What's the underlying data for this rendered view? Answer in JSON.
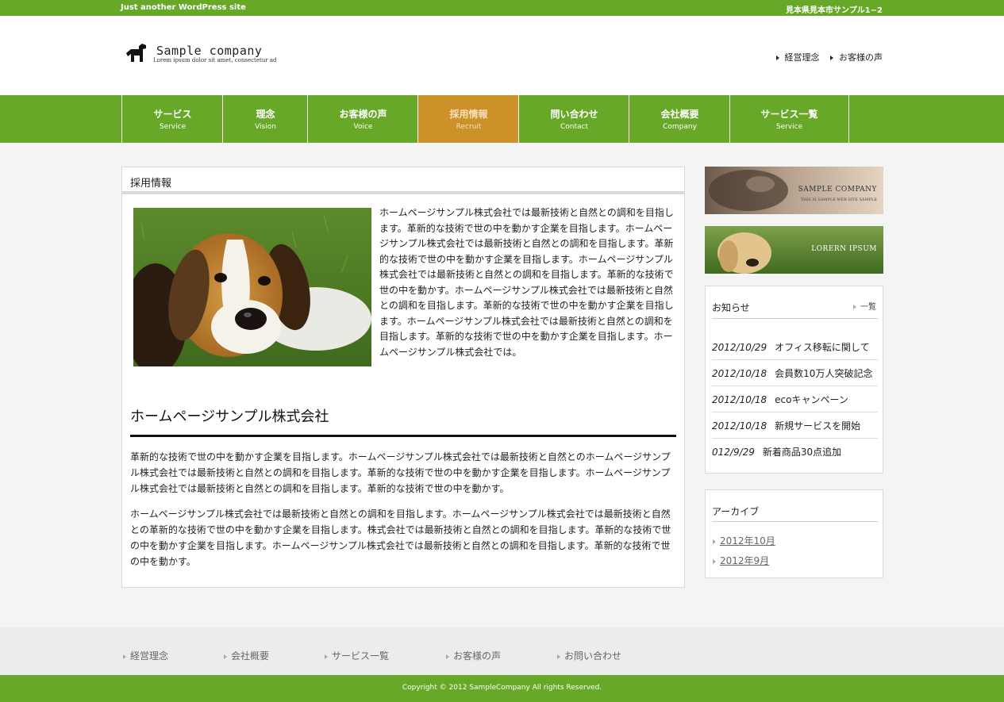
{
  "topbar": {
    "tagline": "Just another WordPress site",
    "address": "見本県見本市サンプル1−2"
  },
  "logo": {
    "name": "Sample company",
    "tagline": "Lorem ipsum dolor sit amet, consectetur ad"
  },
  "header_links": [
    "経営理念",
    "お客様の声"
  ],
  "nav": [
    {
      "jp": "サービス",
      "en": "Service",
      "active": false
    },
    {
      "jp": "理念",
      "en": "Vision",
      "active": false
    },
    {
      "jp": "お客様の声",
      "en": "Voice",
      "active": false
    },
    {
      "jp": "採用情報",
      "en": "Recruit",
      "active": true
    },
    {
      "jp": "問い合わせ",
      "en": "Contact",
      "active": false
    },
    {
      "jp": "会社概要",
      "en": "Company",
      "active": false
    },
    {
      "jp": "サービス一覧",
      "en": "Service",
      "active": false
    }
  ],
  "main": {
    "page_title": "採用情報",
    "intro": "ホームページサンプル株式会社では最新技術と自然との調和を目指します。革新的な技術で世の中を動かす企業を目指します。ホームページサンプル株式会社では最新技術と自然との調和を目指します。革新的な技術で世の中を動かす企業を目指します。ホームページサンプル株式会社では最新技術と自然との調和を目指します。革新的な技術で世の中を動かす。ホームページサンプル株式会社では最新技術と自然との調和を目指します。革新的な技術で世の中を動かす企業を目指します。ホームページサンプル株式会社では最新技術と自然との調和を目指します。革新的な技術で世の中を動かす企業を目指します。ホームページサンプル株式会社では。",
    "heading": "ホームページサンプル株式会社",
    "paragraph1": "革新的な技術で世の中を動かす企業を目指します。ホームページサンプル株式会社では最新技術と自然とのホームページサンプル株式会社では最新技術と自然との調和を目指します。革新的な技術で世の中を動かす企業を目指します。ホームページサンプル株式会社では最新技術と自然との調和を目指します。革新的な技術で世の中を動かす。",
    "paragraph2": "ホームページサンプル株式会社では最新技術と自然との調和を目指します。ホームページサンプル株式会社では最新技術と自然との革新的な技術で世の中を動かす企業を目指します。株式会社では最新技術と自然との調和を目指します。革新的な技術で世の中を動かす企業を目指します。ホームページサンプル株式会社では最新技術と自然との調和を目指します。革新的な技術で世の中を動かす。"
  },
  "banners": {
    "banner1_title": "SAMPLE COMPANY",
    "banner1_sub": "THIS IS SAMPLE WEB SITE SAMPLE",
    "banner2_title": "LORERN IPSUM"
  },
  "news": {
    "title": "お知らせ",
    "more": "一覧",
    "items": [
      {
        "date": "2012/10/29",
        "text": "オフィス移転に関して"
      },
      {
        "date": "2012/10/18",
        "text": "会員数10万人突破記念"
      },
      {
        "date": "2012/10/18",
        "text": "ecoキャンペーン"
      },
      {
        "date": "2012/10/18",
        "text": "新規サービスを開始"
      },
      {
        "date": "012/9/29",
        "text": "新着商品30点追加"
      }
    ]
  },
  "archive": {
    "title": "アーカイブ",
    "items": [
      "2012年10月",
      "2012年9月"
    ]
  },
  "footer_links": [
    "経営理念",
    "会社概要",
    "サービス一覧",
    "お客様の声",
    "お問い合わせ"
  ],
  "copyright": "Copyright © 2012 SampleCompany All rights Reserved.",
  "colors": {
    "brand_green": "#67a828",
    "active_orange": "#cc9129"
  }
}
